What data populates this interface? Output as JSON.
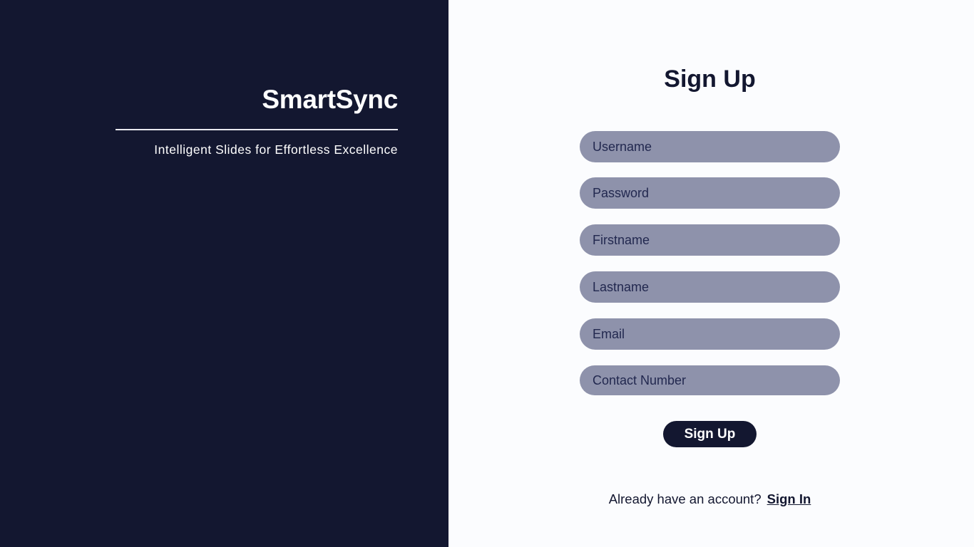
{
  "brand": {
    "title": "SmartSync",
    "tagline": "Intelligent Slides for Effortless Excellence"
  },
  "form": {
    "title": "Sign Up",
    "fields": {
      "username": {
        "placeholder": "Username",
        "value": ""
      },
      "password": {
        "placeholder": "Password",
        "value": ""
      },
      "firstname": {
        "placeholder": "Firstname",
        "value": ""
      },
      "lastname": {
        "placeholder": "Lastname",
        "value": ""
      },
      "email": {
        "placeholder": "Email",
        "value": ""
      },
      "contact": {
        "placeholder": "Contact Number",
        "value": ""
      }
    },
    "submit_label": "Sign Up"
  },
  "footer": {
    "prompt": "Already have an account?",
    "signin_label": "Sign In"
  },
  "colors": {
    "brand_panel_bg": "#131730",
    "form_panel_bg": "#fbfcfe",
    "field_bg": "#8e92ab",
    "accent": "#131730"
  }
}
